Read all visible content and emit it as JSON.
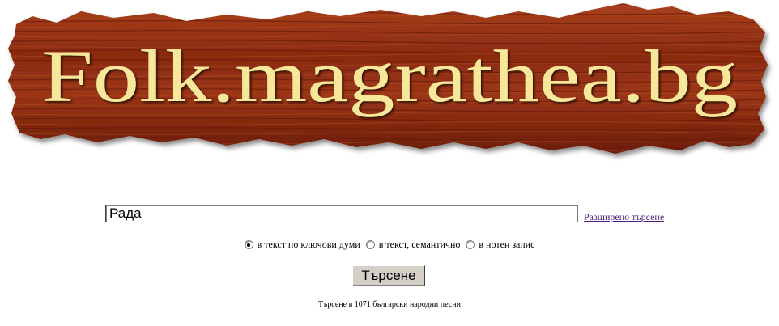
{
  "logo": {
    "text": "Folk.magrathea.bg",
    "text_color": "#f6e79a",
    "wood_color": "#8a2a10",
    "wood_dark": "#5a1406"
  },
  "search": {
    "value": "Рада",
    "advanced_link": "Разширено търсене"
  },
  "search_modes": [
    {
      "label": "в текст по ключови думи",
      "checked": true
    },
    {
      "label": "в текст, семантично",
      "checked": false
    },
    {
      "label": "в нотен запис",
      "checked": false
    }
  ],
  "search_button": "Търсене",
  "footer": "Търсене в 1071 български народни песни"
}
